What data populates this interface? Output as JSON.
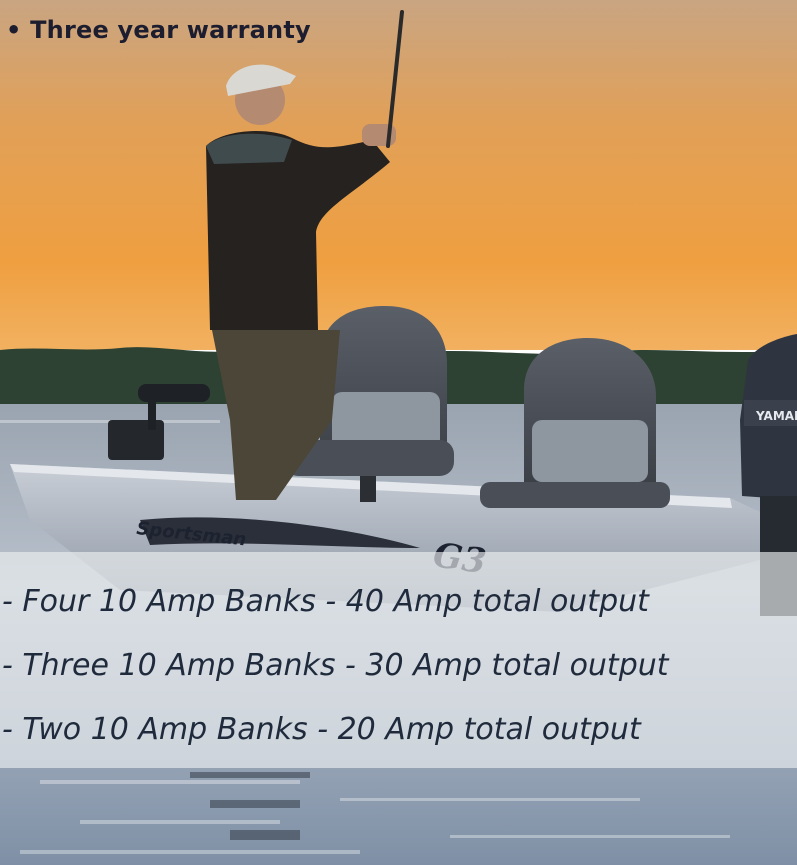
{
  "warranty": {
    "text": "• Three year warranty"
  },
  "specs": {
    "items": [
      "- Four 10 Amp Banks - 40 Amp total output",
      "- Three 10 Amp Banks - 30 Amp total output",
      "- Two 10 Amp Banks - 20 Amp total output"
    ]
  },
  "boat": {
    "hull_brand": "G3",
    "hull_model": "Sportsman",
    "engine_brand": "YAMAHA"
  },
  "colors": {
    "sky_top": "#c8a27a",
    "sky_mid": "#e79d3e",
    "sky_low": "#f0a64a",
    "water": "#a8b4c2",
    "text": "#1c1d2f"
  }
}
